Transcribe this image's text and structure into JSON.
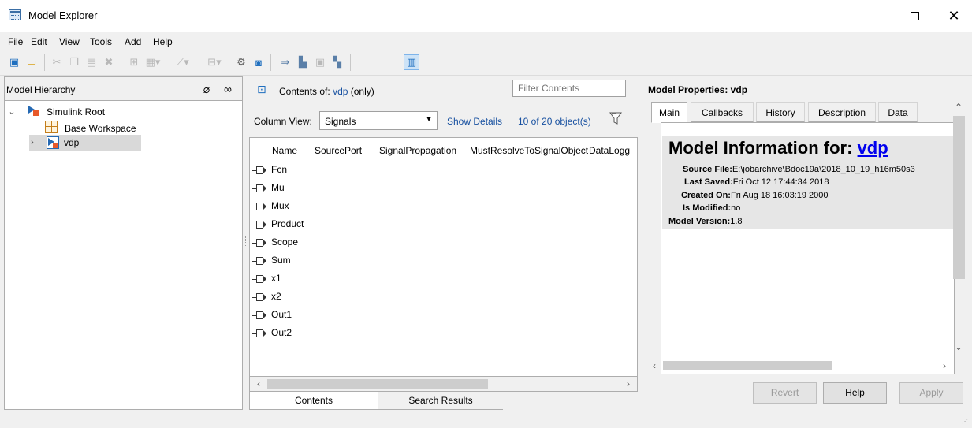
{
  "window": {
    "title": "Model Explorer"
  },
  "menu": [
    "File",
    "Edit",
    "View",
    "Tools",
    "Add",
    "Help"
  ],
  "hierarchy": {
    "header": "Model Hierarchy",
    "items": [
      {
        "label": "Simulink Root"
      },
      {
        "label": "Base Workspace"
      },
      {
        "label": "vdp"
      }
    ]
  },
  "contents": {
    "label_prefix": "Contents of:",
    "model": "vdp",
    "scope": "(only)",
    "filter_placeholder": "Filter Contents",
    "column_view_label": "Column View:",
    "column_view_value": "Signals",
    "show_details": "Show Details",
    "object_count": "10 of 20 object(s)",
    "columns": [
      "Name",
      "SourcePort",
      "SignalPropagation",
      "MustResolveToSignalObject",
      "DataLogg"
    ],
    "rows": [
      "Fcn",
      "Mu",
      "Mux",
      "Product",
      "Scope",
      "Sum",
      "x1",
      "x2",
      "Out1",
      "Out2"
    ],
    "tabs": [
      "Contents",
      "Search Results"
    ]
  },
  "properties": {
    "title": "Model Properties: vdp",
    "tabs": [
      "Main",
      "Callbacks",
      "History",
      "Description",
      "Data"
    ],
    "heading": "Model Information for:",
    "heading_link": "vdp",
    "source_file_label": "Source File:",
    "source_file_value": "E:\\jobarchive\\Bdoc19a\\2018_10_19_h16m50s3",
    "last_saved_label": "Last Saved:",
    "last_saved_value": "Fri Oct 12 17:44:34 2018",
    "created_on_label": "Created On:",
    "created_on_value": "Fri Aug 18 16:03:19 2000",
    "is_modified_label": "Is Modified:",
    "is_modified_value": "no",
    "model_version_label": "Model Version:",
    "model_version_value": "1.8"
  },
  "buttons": {
    "revert": "Revert",
    "help": "Help",
    "apply": "Apply"
  }
}
